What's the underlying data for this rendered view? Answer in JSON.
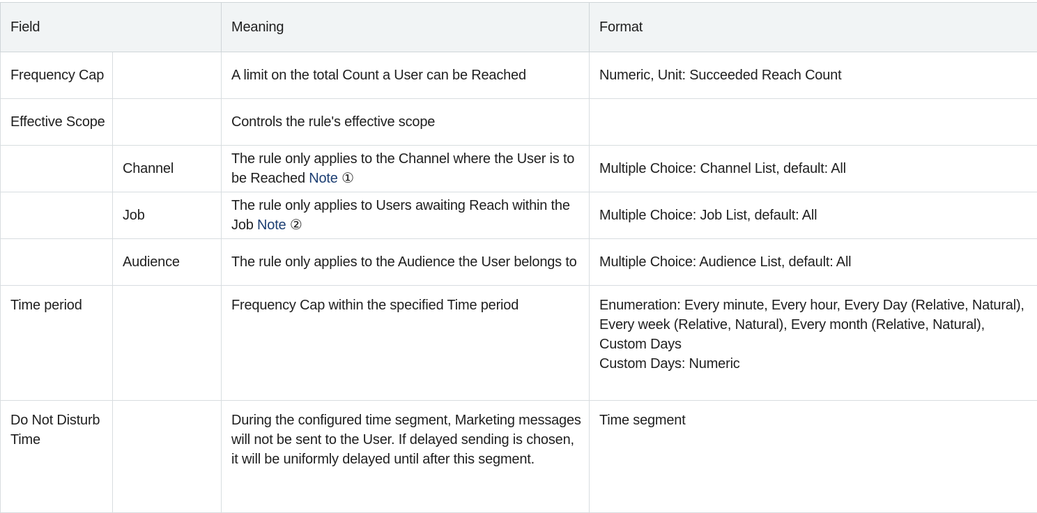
{
  "header": {
    "field": "Field",
    "meaning": "Meaning",
    "format": "Format"
  },
  "rows": [
    {
      "field": "Frequency Cap",
      "subfield": "",
      "meaning": "A limit on the total Count a User can be Reached",
      "format": "Numeric, Unit: Succeeded Reach Count"
    },
    {
      "field": "Effective Scope",
      "subfield": "",
      "meaning": "Controls the rule's effective scope",
      "format": ""
    },
    {
      "field": "",
      "subfield": "Channel",
      "meaning": "The rule only applies to the Channel where the User is to be Reached",
      "note_label": "Note",
      "note_symbol": "①",
      "format": "Multiple Choice: Channel List, default: All"
    },
    {
      "field": "",
      "subfield": "Job",
      "meaning": "The rule only applies to Users awaiting Reach within the Job",
      "note_label": "Note",
      "note_symbol": "②",
      "format": "Multiple Choice: Job List, default: All"
    },
    {
      "field": "",
      "subfield": "Audience",
      "meaning": "The rule only applies to the Audience the User belongs to",
      "format": "Multiple Choice: Audience List, default: All"
    },
    {
      "field": "Time period",
      "subfield": "",
      "meaning": "Frequency Cap within the specified Time period",
      "format_line1": "Enumeration: Every minute, Every hour, Every Day (Relative, Natural), Every week (Relative, Natural), Every month (Relative, Natural), Custom Days",
      "format_line2": "Custom Days: Numeric"
    },
    {
      "field": "Do Not Disturb Time",
      "subfield": "",
      "meaning": "During the configured time segment, Marketing messages will not be sent to the User. If delayed sending is chosen, it will be uniformly delayed until after this segment.",
      "format": "Time segment"
    }
  ],
  "colors": {
    "header_bg": "#f1f4f5",
    "border": "#d8dde0",
    "note_link": "#1d3f73",
    "text": "#1f1f1f"
  }
}
